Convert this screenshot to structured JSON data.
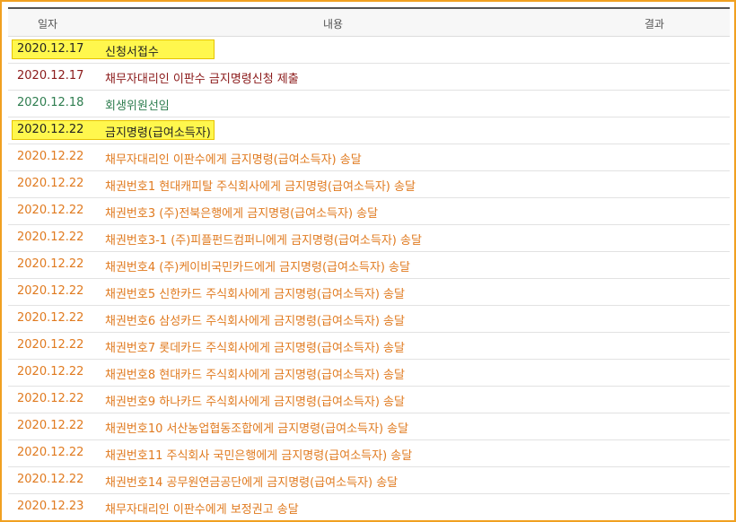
{
  "header": {
    "date_label": "일자",
    "content_label": "내용",
    "result_label": "결과"
  },
  "colors": {
    "frame_border": "#f0a020",
    "highlight": "#fff74d",
    "orange_text": "#e07a1f",
    "maroon_text": "#8b1a1a",
    "green_text": "#2e7d4f"
  },
  "rows": [
    {
      "date": "2020.12.17",
      "content": "신청서접수",
      "color": "black",
      "highlighted": true
    },
    {
      "date": "2020.12.17",
      "content": "채무자대리인 이판수 금지명령신청 제출",
      "color": "maroon",
      "highlighted": false
    },
    {
      "date": "2020.12.18",
      "content": "회생위원선임",
      "color": "green",
      "highlighted": false
    },
    {
      "date": "2020.12.22",
      "content": "금지명령(급여소득자)",
      "color": "black",
      "highlighted": true
    },
    {
      "date": "2020.12.22",
      "content": "채무자대리인 이판수에게 금지명령(급여소득자) 송달",
      "color": "orange",
      "highlighted": false
    },
    {
      "date": "2020.12.22",
      "content": "채권번호1 현대캐피탈 주식회사에게 금지명령(급여소득자) 송달",
      "color": "orange",
      "highlighted": false
    },
    {
      "date": "2020.12.22",
      "content": "채권번호3 (주)전북은행에게 금지명령(급여소득자) 송달",
      "color": "orange",
      "highlighted": false
    },
    {
      "date": "2020.12.22",
      "content": "채권번호3-1 (주)피플펀드컴퍼니에게 금지명령(급여소득자) 송달",
      "color": "orange",
      "highlighted": false
    },
    {
      "date": "2020.12.22",
      "content": "채권번호4 (주)케이비국민카드에게 금지명령(급여소득자) 송달",
      "color": "orange",
      "highlighted": false
    },
    {
      "date": "2020.12.22",
      "content": "채권번호5 신한카드 주식회사에게 금지명령(급여소득자) 송달",
      "color": "orange",
      "highlighted": false
    },
    {
      "date": "2020.12.22",
      "content": "채권번호6 삼성카드 주식회사에게 금지명령(급여소득자) 송달",
      "color": "orange",
      "highlighted": false
    },
    {
      "date": "2020.12.22",
      "content": "채권번호7 롯데카드 주식회사에게 금지명령(급여소득자) 송달",
      "color": "orange",
      "highlighted": false
    },
    {
      "date": "2020.12.22",
      "content": "채권번호8 현대카드 주식회사에게 금지명령(급여소득자) 송달",
      "color": "orange",
      "highlighted": false
    },
    {
      "date": "2020.12.22",
      "content": "채권번호9 하나카드 주식회사에게 금지명령(급여소득자) 송달",
      "color": "orange",
      "highlighted": false
    },
    {
      "date": "2020.12.22",
      "content": "채권번호10 서산농업협동조합에게 금지명령(급여소득자) 송달",
      "color": "orange",
      "highlighted": false
    },
    {
      "date": "2020.12.22",
      "content": "채권번호11 주식회사 국민은행에게 금지명령(급여소득자) 송달",
      "color": "orange",
      "highlighted": false
    },
    {
      "date": "2020.12.22",
      "content": "채권번호14 공무원연금공단에게 금지명령(급여소득자) 송달",
      "color": "orange",
      "highlighted": false
    },
    {
      "date": "2020.12.23",
      "content": "채무자대리인 이판수에게 보정권고 송달",
      "color": "orange",
      "highlighted": false
    }
  ]
}
